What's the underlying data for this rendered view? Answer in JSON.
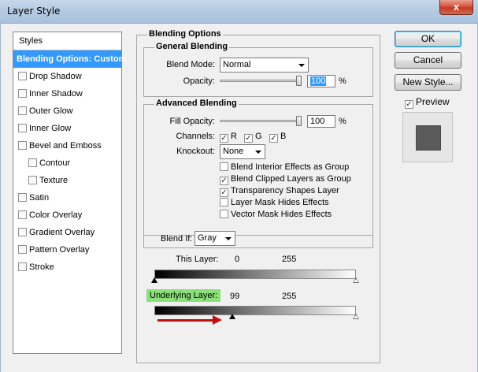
{
  "window": {
    "title": "Layer Style",
    "close_glyph": "x"
  },
  "styles_list": {
    "header": "Styles",
    "items": [
      {
        "label": "Blending Options: Custom",
        "selected": true,
        "sub": false
      },
      {
        "label": "Drop Shadow",
        "sub": false
      },
      {
        "label": "Inner Shadow",
        "sub": false
      },
      {
        "label": "Outer Glow",
        "sub": false
      },
      {
        "label": "Inner Glow",
        "sub": false
      },
      {
        "label": "Bevel and Emboss",
        "sub": false
      },
      {
        "label": "Contour",
        "sub": true
      },
      {
        "label": "Texture",
        "sub": true
      },
      {
        "label": "Satin",
        "sub": false
      },
      {
        "label": "Color Overlay",
        "sub": false
      },
      {
        "label": "Gradient Overlay",
        "sub": false
      },
      {
        "label": "Pattern Overlay",
        "sub": false
      },
      {
        "label": "Stroke",
        "sub": false
      }
    ]
  },
  "blending_options": {
    "title": "Blending Options",
    "general": {
      "title": "General Blending",
      "blend_mode_label": "Blend Mode:",
      "blend_mode_value": "Normal",
      "opacity_label": "Opacity:",
      "opacity_value": "100",
      "opacity_level": 1.0,
      "unit": "%"
    },
    "advanced": {
      "title": "Advanced Blending",
      "fill_opacity_label": "Fill Opacity:",
      "fill_opacity_value": "100",
      "fill_opacity_level": 1.0,
      "unit": "%",
      "channels_label": "Channels:",
      "channel_r": "R",
      "channel_g": "G",
      "channel_b": "B",
      "check_glyph": "✓",
      "knockout_label": "Knockout:",
      "knockout_value": "None",
      "options": [
        {
          "label": "Blend Interior Effects as Group",
          "checked": false
        },
        {
          "label": "Blend Clipped Layers as Group",
          "checked": true
        },
        {
          "label": "Transparency Shapes Layer",
          "checked": true
        },
        {
          "label": "Layer Mask Hides Effects",
          "checked": false
        },
        {
          "label": "Vector Mask Hides Effects",
          "checked": false
        }
      ]
    },
    "blend_if": {
      "label": "Blend If:",
      "value": "Gray",
      "this_layer_label": "This Layer:",
      "this_layer_low": "0",
      "this_layer_high": "255",
      "underlying_label": "Underlying Layer:",
      "underlying_low": "99",
      "underlying_high": "255",
      "underlying_highlight_color": "#8be07a",
      "annotation_arrow_color": "#c0100e"
    }
  },
  "buttons": {
    "ok": "OK",
    "cancel": "Cancel",
    "new_style": "New Style...",
    "preview_label": "Preview",
    "preview_checked": true
  }
}
